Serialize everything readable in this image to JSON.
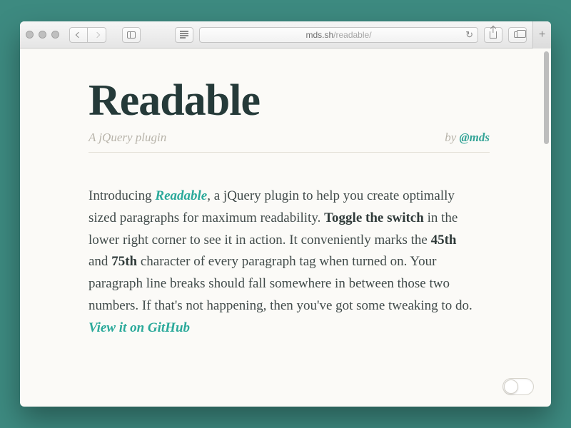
{
  "browser": {
    "url_host": "mds.sh",
    "url_path": "/readable/"
  },
  "page": {
    "title": "Readable",
    "tagline": "A jQuery plugin",
    "by_prefix": "by ",
    "author_handle": "@mds",
    "intro_prefix": "Introducing ",
    "product_name": "Readable",
    "intro_mid": ", a jQuery plugin to help you create optimally sized paragraphs for maximum readability. ",
    "bold_toggle": "Toggle the switch",
    "after_toggle": " in the lower right corner to see it in action. It conveniently marks the ",
    "char_45": "45th",
    "between_chars": " and ",
    "char_75": "75th",
    "after_chars": " character of every paragraph tag when turned on. Your paragraph line breaks should fall somewhere in between those two numbers. If that's not happening, then you've got some tweaking to do. ",
    "github_link": "View it on GitHub"
  },
  "toggle": {
    "state": "off"
  }
}
